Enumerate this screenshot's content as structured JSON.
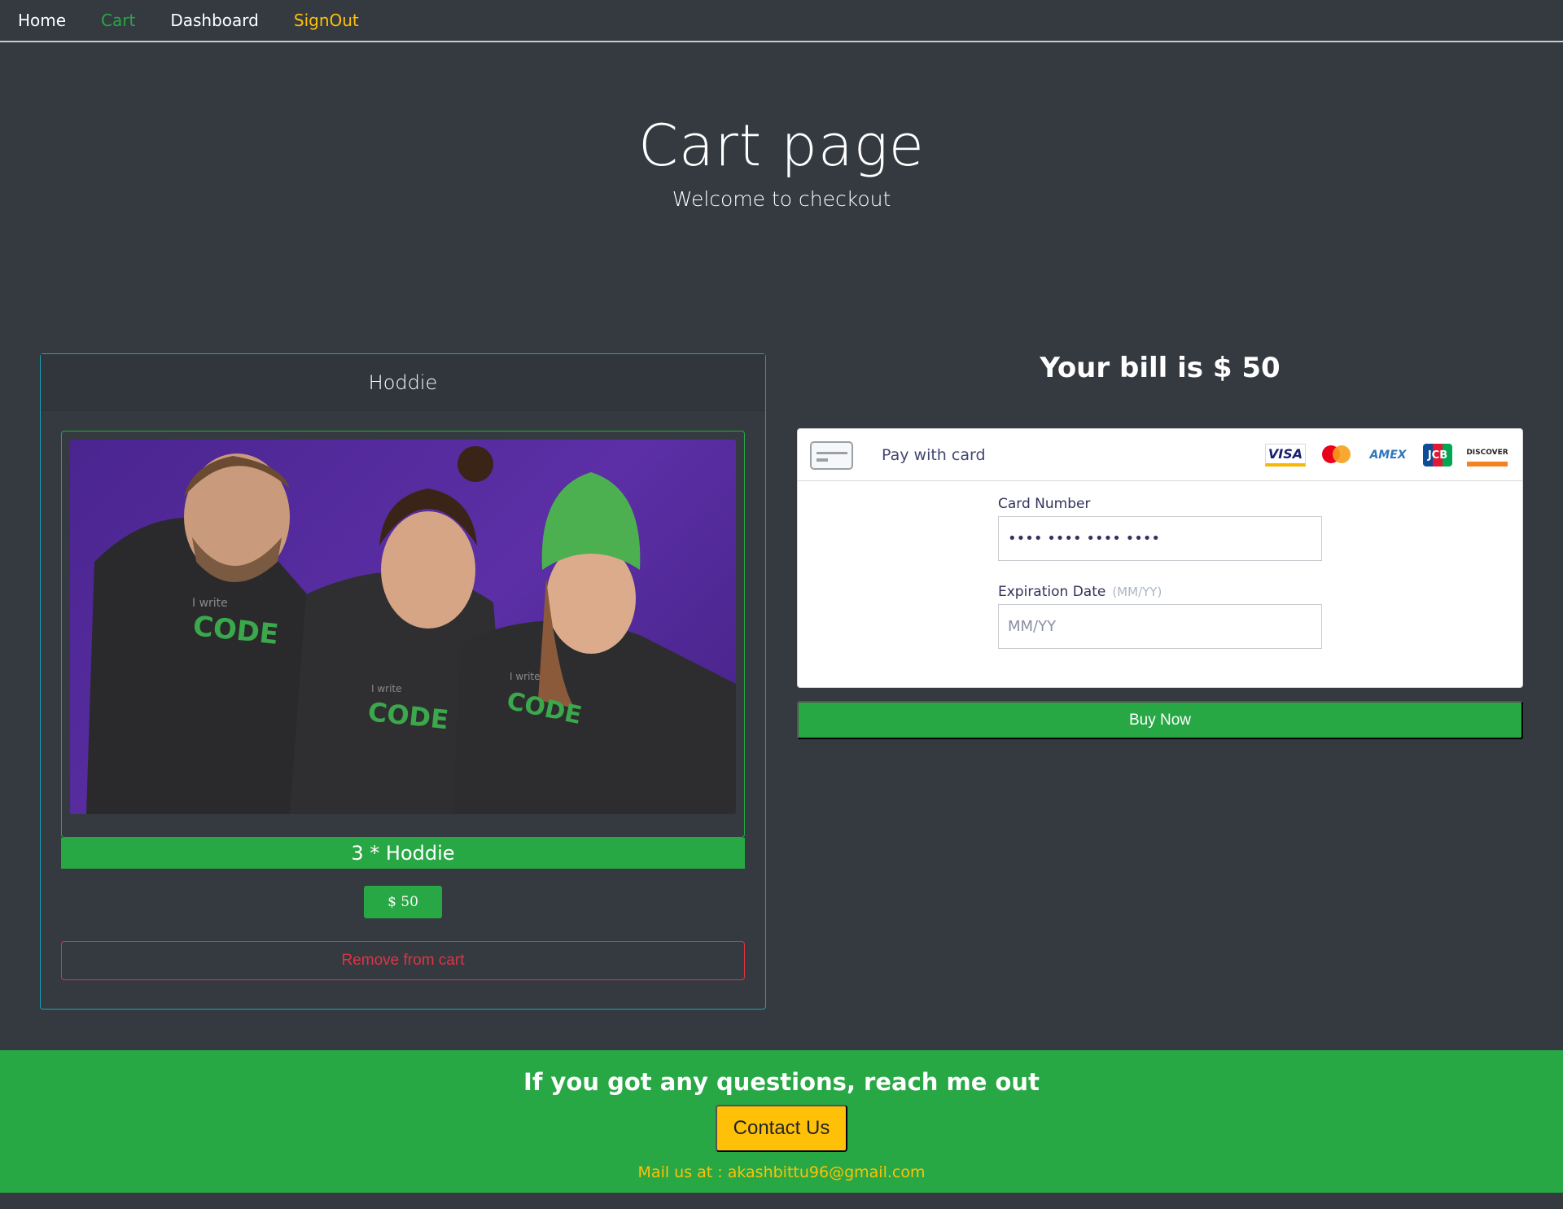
{
  "nav": {
    "home": "Home",
    "cart": "Cart",
    "dashboard": "Dashboard",
    "signout": "SignOut",
    "colors": {
      "default": "#ffffff",
      "cart": "#28a745",
      "signout": "#ffc107"
    }
  },
  "hero": {
    "title": "Cart page",
    "subtitle": "Welcome to checkout"
  },
  "product": {
    "name": "Hoddie",
    "image_icon": "product-photo",
    "quantity_label": "3 * Hoddie",
    "price": "$ 50",
    "remove_label": "Remove from cart"
  },
  "checkout": {
    "bill": "Your bill is $ 50",
    "pay_label": "Pay with card",
    "brands": {
      "visa": "VISA",
      "amex": "AMEX",
      "jcb": "JCB",
      "discover": "DISCOVER"
    },
    "card_number_label": "Card Number",
    "card_number_value": "•••• •••• •••• ••••",
    "expiration_label": "Expiration Date",
    "expiration_hint": "(MM/YY)",
    "expiration_placeholder": "MM/YY",
    "buy_label": "Buy Now"
  },
  "footer": {
    "title": "If you got any questions, reach me out",
    "contact_label": "Contact Us",
    "mail": "Mail us at : akashbittu96@gmail.com"
  },
  "colors": {
    "background": "#343a40",
    "success": "#28a745",
    "warning": "#ffc107",
    "danger": "#dc3545",
    "info": "#17a2b8"
  }
}
